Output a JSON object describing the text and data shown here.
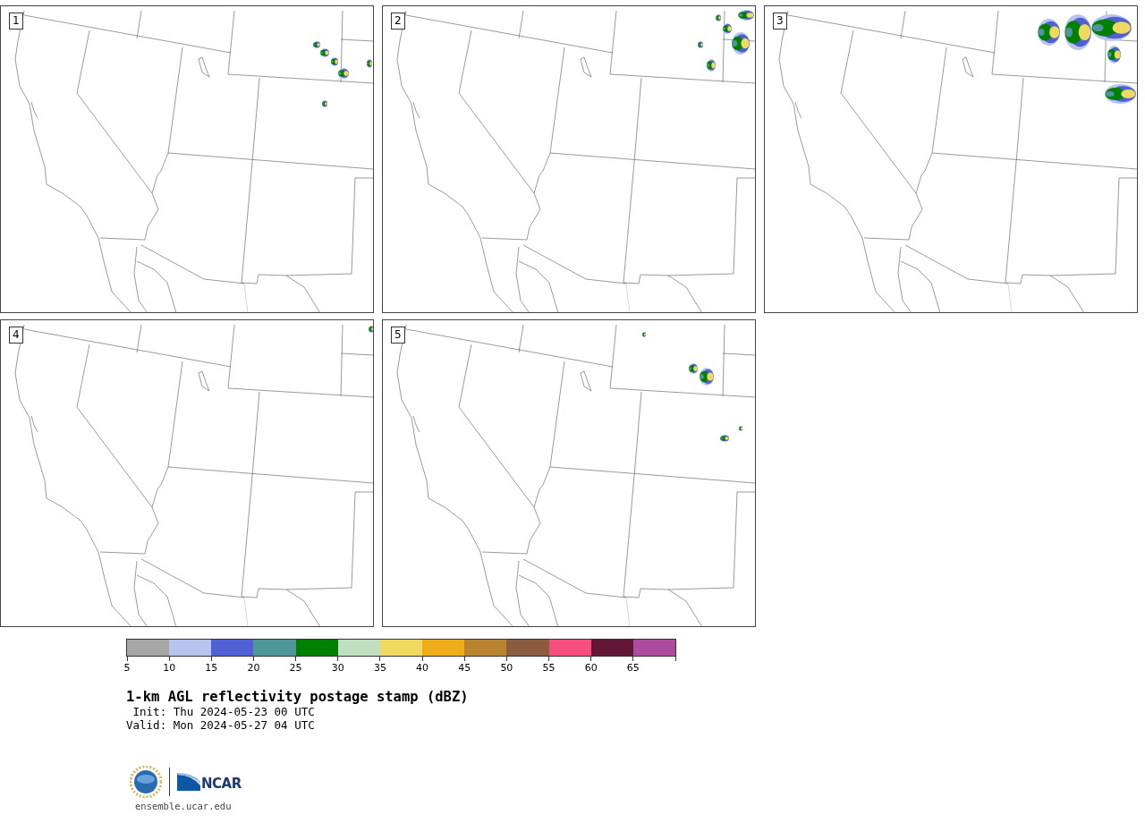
{
  "panels": [
    {
      "label": "1"
    },
    {
      "label": "2"
    },
    {
      "label": "3"
    },
    {
      "label": "4"
    },
    {
      "label": "5"
    }
  ],
  "colorbar": {
    "segments": [
      {
        "color": "#a6a6a6"
      },
      {
        "color": "#b8c4ef"
      },
      {
        "color": "#505fd4"
      },
      {
        "color": "#4f969a"
      },
      {
        "color": "#008000"
      },
      {
        "color": "#c0dfbf"
      },
      {
        "color": "#efda5f"
      },
      {
        "color": "#efae18"
      },
      {
        "color": "#b98430"
      },
      {
        "color": "#8b5b3f"
      },
      {
        "color": "#f54e7f"
      },
      {
        "color": "#611735"
      },
      {
        "color": "#ad4ba1"
      }
    ],
    "ticks": [
      "5",
      "10",
      "15",
      "20",
      "25",
      "30",
      "35",
      "40",
      "45",
      "50",
      "55",
      "60",
      "65"
    ]
  },
  "title": "1-km AGL reflectivity postage stamp (dBZ)",
  "init": " Init: Thu 2024-05-23 00 UTC",
  "valid": "Valid: Mon 2024-05-27 04 UTC",
  "logo": {
    "text": "NCAR"
  },
  "url": "ensemble.ucar.edu"
}
